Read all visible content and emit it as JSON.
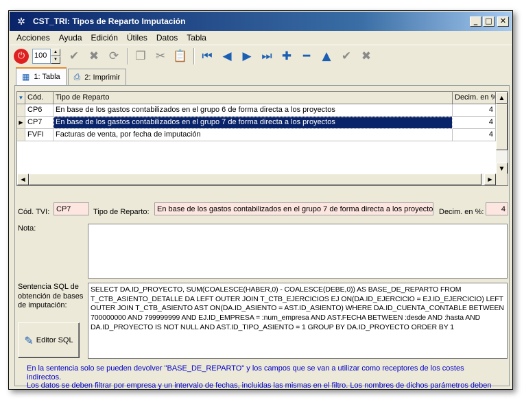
{
  "window": {
    "title": "CST_TRI: Tipos de Reparto Imputación",
    "minimize": "_",
    "maximize": "□",
    "close": "✕"
  },
  "menu": [
    "Acciones",
    "Ayuda",
    "Edición",
    "Útiles",
    "Datos",
    "Tabla"
  ],
  "toolbar": {
    "zoom_value": "100",
    "tools": [
      {
        "name": "check-icon",
        "glyph": "✔",
        "disabled": true
      },
      {
        "name": "cancel-icon",
        "glyph": "✖",
        "disabled": true
      },
      {
        "name": "refresh-icon",
        "glyph": "⟳",
        "disabled": true
      },
      {
        "name": "copy-icon",
        "glyph": "❐",
        "disabled": true
      },
      {
        "name": "cut-icon",
        "glyph": "✂",
        "disabled": true
      },
      {
        "name": "paste-icon",
        "glyph": "📋",
        "disabled": true
      },
      {
        "name": "first-record-icon",
        "glyph": "⏮",
        "disabled": false
      },
      {
        "name": "prev-record-icon",
        "glyph": "◀",
        "disabled": false
      },
      {
        "name": "next-record-icon",
        "glyph": "▶",
        "disabled": false
      },
      {
        "name": "last-record-icon",
        "glyph": "⏭",
        "disabled": false
      },
      {
        "name": "add-record-icon",
        "glyph": "✚",
        "disabled": false
      },
      {
        "name": "delete-record-icon",
        "glyph": "━",
        "disabled": false
      },
      {
        "name": "edit-record-icon",
        "glyph": "▲",
        "disabled": false
      },
      {
        "name": "post-record-icon",
        "glyph": "✔",
        "disabled": true
      },
      {
        "name": "cancel-record-icon",
        "glyph": "✖",
        "disabled": true
      }
    ]
  },
  "tabs": [
    {
      "label": "1: Tabla",
      "icon": "table-icon",
      "glyph": "▦",
      "active": true
    },
    {
      "label": "2: Imprimir",
      "icon": "printer-icon",
      "glyph": "⎙",
      "active": false
    }
  ],
  "grid": {
    "headers": {
      "code": "Cód.",
      "tipo": "Tipo de Reparto",
      "decim": "Decim. en %"
    },
    "rows": [
      {
        "code": "CP6",
        "tipo": "En base de los gastos contabilizados en el grupo 6 de forma directa a los proyectos",
        "decim": "4",
        "current": false
      },
      {
        "code": "CP7",
        "tipo": "En base de los gastos contabilizados en el grupo 7 de forma directa a los proyectos",
        "decim": "4",
        "current": true
      },
      {
        "code": "FVFI",
        "tipo": "Facturas de venta, por fecha de imputación",
        "decim": "4",
        "current": false
      }
    ]
  },
  "form": {
    "cod_label": "Cód. TVI:",
    "cod_value": "CP7",
    "tipo_label": "Tipo de Reparto:",
    "tipo_value": "En base de los gastos contabilizados en el grupo 7 de forma directa a los proyectos",
    "decim_label": "Decim. en %:",
    "decim_value": "4",
    "nota_label": "Nota:",
    "nota_value": "",
    "sql_label": "Sentencia SQL de obtención de bases de imputación:",
    "sql_value": "SELECT DA.ID_PROYECTO, SUM(COALESCE(HABER,0) -  COALESCE(DEBE,0)) AS BASE_DE_REPARTO FROM T_CTB_ASIENTO_DETALLE DA LEFT OUTER JOIN T_CTB_EJERCICIOS EJ ON(DA.ID_EJERCICIO = EJ.ID_EJERCICIO) LEFT OUTER JOIN T_CTB_ASIENTO AST ON(DA.ID_ASIENTO = AST.ID_ASIENTO) WHERE DA.ID_CUENTA_CONTABLE BETWEEN 700000000 AND 799999999 AND EJ.ID_EMPRESA = :num_empresa AND AST.FECHA BETWEEN :desde AND :hasta AND DA.ID_PROYECTO IS NOT NULL AND AST.ID_TIPO_ASIENTO = 1 GROUP BY DA.ID_PROYECTO ORDER BY 1",
    "editor_label": "Editor SQL"
  },
  "note": {
    "line1": "En la sentencia solo se pueden devolver \"BASE_DE_REPARTO\" y los campos que se van a utilizar como receptores de los costes indirectos.",
    "line2": "Los datos se deben filtrar por empresa  y un intervalo de fechas, incluidas las mismas en el filtro. Los nombres de dichos parámetros deben"
  },
  "colors": {
    "title_gradient_start": "#0a246a",
    "selection": "#0a246a",
    "field_bg": "#fde6e0",
    "note_text": "#0000c8"
  }
}
